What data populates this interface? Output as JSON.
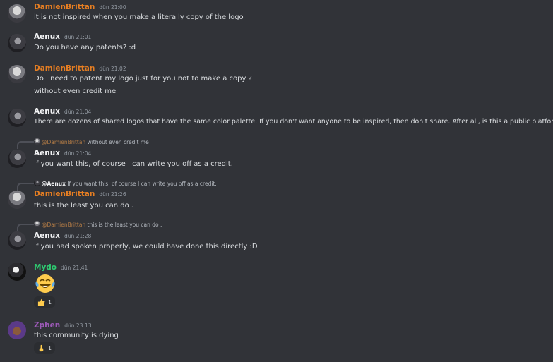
{
  "messages": [
    {
      "author": "DamienBrittan",
      "time": "dün 21:00",
      "lines": [
        "it is not inspired when you make a literally copy of the logo"
      ]
    },
    {
      "author": "Aenux",
      "time": "dün 21:01",
      "lines": [
        "Do you have any patents? :d"
      ]
    },
    {
      "author": "DamienBrittan",
      "time": "dün 21:02",
      "lines": [
        "Do I need to patent my logo just for you not to make a copy ?",
        "without even credit me"
      ]
    },
    {
      "author": "Aenux",
      "time": "dün 21:04",
      "lines": [
        "There are dozens of shared logos that have the same color palette. If you don't want anyone to be inspired, then don't share. After all, is this a public platform?"
      ]
    },
    {
      "reply": {
        "mention": "@DamienBrittan",
        "text": "without even credit me"
      },
      "author": "Aenux",
      "time": "dün 21:04",
      "lines": [
        "If you want this, of course I can write you off as a credit."
      ]
    },
    {
      "reply": {
        "mention": "@Aenux",
        "text": "If you want this, of course I can write you off as a credit."
      },
      "author": "DamienBrittan",
      "time": "dün 21:26",
      "lines": [
        "this is the least you can do ."
      ]
    },
    {
      "reply": {
        "mention": "@DamienBrittan",
        "text": "this is the least you can do ."
      },
      "author": "Aenux",
      "time": "dün 21:28",
      "lines": [
        "If you had spoken properly, we could have done this directly :D"
      ]
    },
    {
      "author": "Mydo",
      "time": "dün 21:41",
      "emoji": "face-with-tears-of-joy",
      "reaction": {
        "icon": "thumbs-up",
        "count": "1"
      }
    },
    {
      "author": "Zphen",
      "time": "dün 23:13",
      "lines": [
        "this community is dying"
      ],
      "reaction": {
        "icon": "pointing-up",
        "count": "1"
      }
    }
  ],
  "colors": {
    "background": "#313338",
    "damien": "#e67e22",
    "aenux": "#f2f3f5",
    "mydo": "#2ecc71",
    "zphen": "#9b59b6"
  }
}
